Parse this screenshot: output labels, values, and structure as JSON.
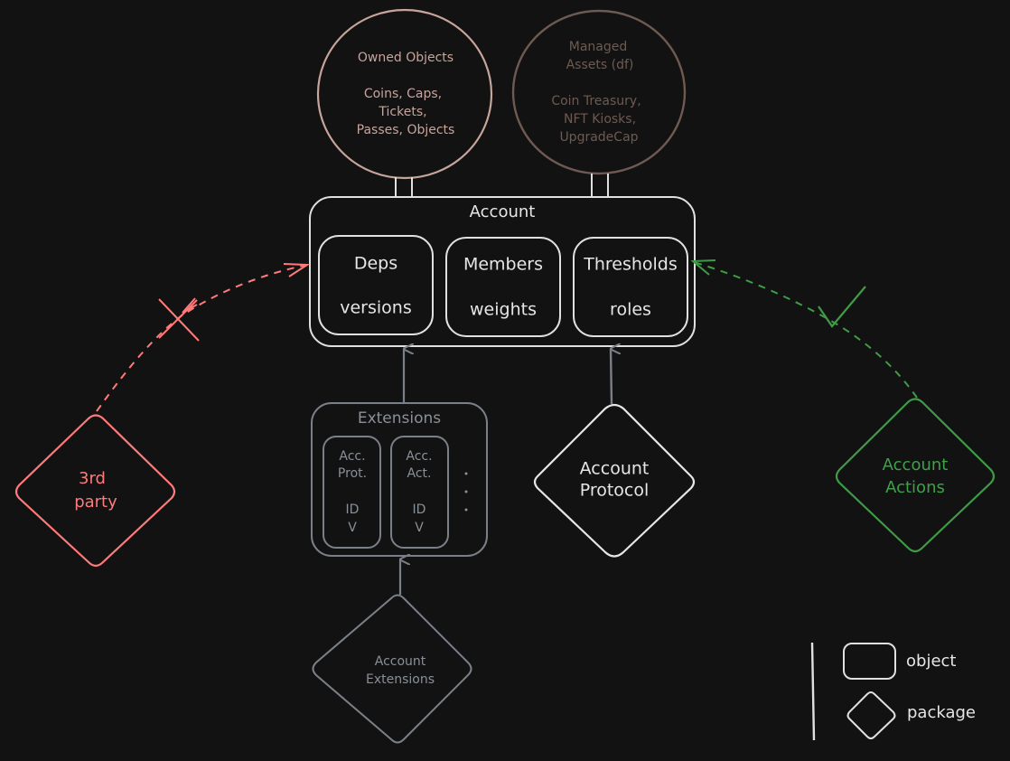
{
  "colors": {
    "background": "#121212",
    "object_stroke": "#e0e0e0",
    "owned_circle": "#c7a59b",
    "managed_circle": "#6e5a52",
    "extension_gray": "#7b8088",
    "third_party_red": "#ff7a7a",
    "actions_green": "#3f9b47"
  },
  "owned_objects": {
    "title": "Owned Objects",
    "lines": [
      "Coins, Caps,",
      "Tickets,",
      "Passes, Objects"
    ]
  },
  "managed_assets": {
    "title_lines": [
      "Managed",
      "Assets (df)"
    ],
    "lines": [
      "Coin Treasury,",
      "NFT Kiosks,",
      "UpgradeCap"
    ]
  },
  "account": {
    "title": "Account",
    "fields": [
      {
        "name": "Deps",
        "sub": "versions"
      },
      {
        "name": "Members",
        "sub": "weights"
      },
      {
        "name": "Thresholds",
        "sub": "roles"
      }
    ]
  },
  "extensions": {
    "title": "Extensions",
    "entries": [
      {
        "lines": [
          "Acc.",
          "Prot."
        ],
        "id": "ID",
        "version": "V"
      },
      {
        "lines": [
          "Acc.",
          "Act."
        ],
        "id": "ID",
        "version": "V"
      }
    ],
    "more": ".\n.\n."
  },
  "packages": {
    "third_party": [
      "3rd",
      "party"
    ],
    "account_protocol": [
      "Account",
      "Protocol"
    ],
    "account_actions": [
      "Account",
      "Actions"
    ],
    "account_extensions": [
      "Account",
      "Extensions"
    ]
  },
  "edges": {
    "third_party_access": "denied",
    "account_actions_access": "allowed"
  },
  "legend": {
    "object": "object",
    "package": "package"
  }
}
